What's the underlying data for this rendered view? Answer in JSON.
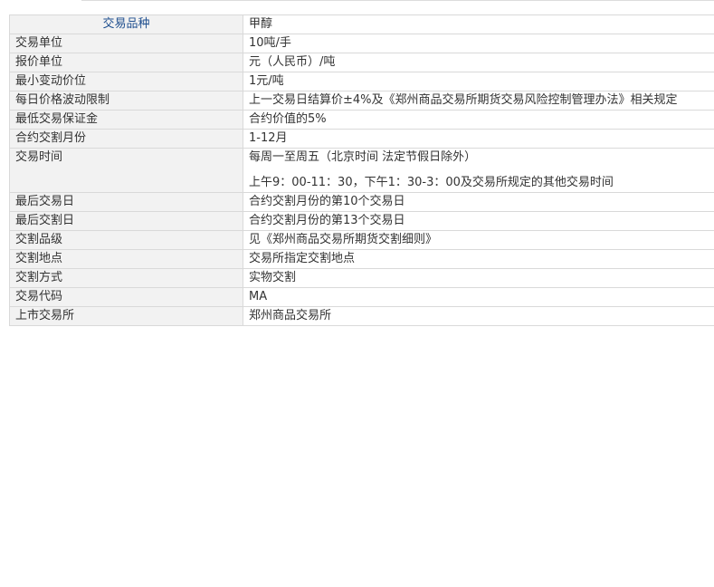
{
  "table": {
    "header": {
      "label": "交易品种",
      "value": "甲醇"
    },
    "rows": [
      {
        "label": "交易单位",
        "value": [
          "10吨/手"
        ]
      },
      {
        "label": "报价单位",
        "value": [
          "元（人民币）/吨"
        ]
      },
      {
        "label": "最小变动价位",
        "value": [
          "1元/吨"
        ]
      },
      {
        "label": "每日价格波动限制",
        "value": [
          "上一交易日结算价±4%及《郑州商品交易所期货交易风险控制管理办法》相关规定"
        ]
      },
      {
        "label": "最低交易保证金",
        "value": [
          "合约价值的5%"
        ]
      },
      {
        "label": "合约交割月份",
        "value": [
          "1-12月"
        ]
      },
      {
        "label": "交易时间",
        "value": [
          "每周一至周五（北京时间 法定节假日除外）",
          "上午9：00-11：30，下午1：30-3：00及交易所规定的其他交易时间"
        ]
      },
      {
        "label": "最后交易日",
        "value": [
          "合约交割月份的第10个交易日"
        ]
      },
      {
        "label": "最后交割日",
        "value": [
          "合约交割月份的第13个交易日"
        ]
      },
      {
        "label": "交割品级",
        "value": [
          "见《郑州商品交易所期货交割细则》"
        ]
      },
      {
        "label": "交割地点",
        "value": [
          "交易所指定交割地点"
        ]
      },
      {
        "label": "交割方式",
        "value": [
          "实物交割"
        ]
      },
      {
        "label": "交易代码",
        "value": [
          "MA"
        ]
      },
      {
        "label": "上市交易所",
        "value": [
          "郑州商品交易所"
        ]
      }
    ]
  }
}
